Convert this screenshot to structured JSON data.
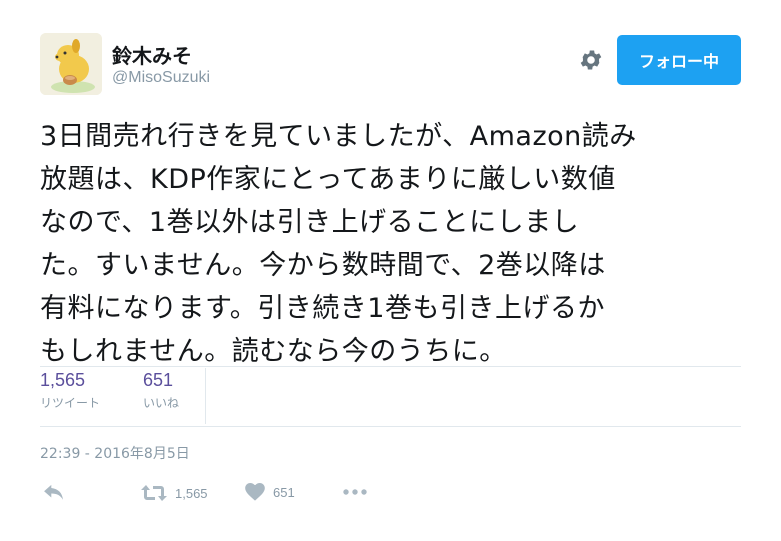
{
  "user": {
    "display_name": "鈴木みそ",
    "handle": "@MisoSuzuki",
    "follow_label": "フォロー中"
  },
  "tweet": {
    "lines": [
      "3日間売れ行きを見ていましたが、Amazon読み",
      "放題は、KDP作家にとってあまりに厳しい数値",
      "なので、1巻以外は引き上げることにしまし",
      "た。すいません。今から数時間で、2巻以降は",
      "有料になります。引き続き1巻も引き上げるか",
      "もしれません。読むなら今のうちに。"
    ],
    "timestamp": "22:39 - 2016年8月5日"
  },
  "stats": {
    "retweets": {
      "count": "1,565",
      "label": "リツイート"
    },
    "likes": {
      "count": "651",
      "label": "いいね"
    }
  },
  "actions": {
    "retweet_count": "1,565",
    "like_count": "651"
  },
  "colors": {
    "accent": "#1da1f2",
    "muted": "#8899a6",
    "stat_number": "#5b4f9c",
    "divider": "#e1e8ed"
  },
  "icons": [
    "gear-icon",
    "reply-icon",
    "retweet-icon",
    "heart-icon",
    "more-icon"
  ]
}
